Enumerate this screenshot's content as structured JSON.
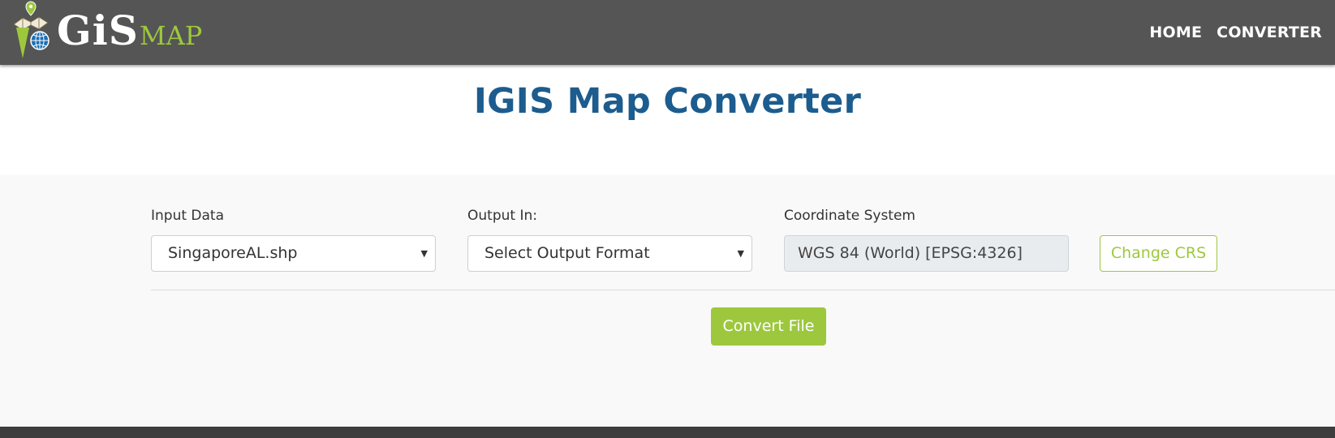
{
  "brand": {
    "logo_gis": "GiS",
    "logo_map": "MAP",
    "logo_i": "i",
    "colors": {
      "green": "#9dc83e",
      "blue": "#1c6fb4",
      "nav": "#555555"
    }
  },
  "nav": {
    "home": "HOME",
    "converter": "CONVERTER"
  },
  "page": {
    "title": "IGIS Map Converter"
  },
  "form": {
    "input_data": {
      "label": "Input Data",
      "value": "SingaporeAL.shp"
    },
    "output": {
      "label": "Output In:",
      "value": "Select Output Format"
    },
    "crs": {
      "label": "Coordinate System",
      "value": "WGS 84 (World) [EPSG:4326]"
    },
    "change_crs_label": "Change CRS",
    "convert_label": "Convert File"
  },
  "icons": {
    "select_arrow": "caret-down-icon",
    "logo_pin": "map-pin-icon",
    "logo_globe": "globe-icon"
  }
}
